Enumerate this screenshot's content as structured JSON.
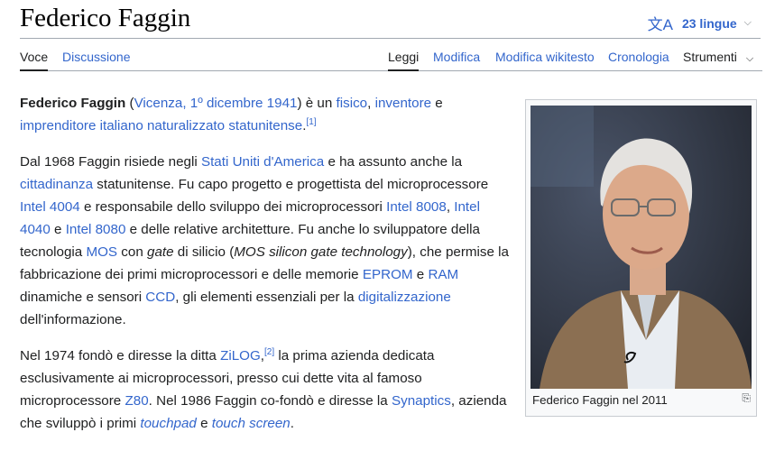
{
  "header": {
    "title": "Federico Faggin",
    "languages_label": "23 lingue"
  },
  "tabs": {
    "voce": "Voce",
    "discussione": "Discussione",
    "leggi": "Leggi",
    "modifica": "Modifica",
    "modifica_wikitesto": "Modifica wikitesto",
    "cronologia": "Cronologia",
    "strumenti": "Strumenti"
  },
  "p1": {
    "name": "Federico Faggin",
    "t1": " (",
    "l1": "Vicenza, 1º dicembre 1941",
    "t2": ") è un ",
    "l2": "fisico",
    "t3": ", ",
    "l3": "inventore",
    "t4": " e ",
    "l4": "imprenditore italiano naturalizzato statunitense",
    "t5": ".",
    "ref": "[1]"
  },
  "p2": {
    "t1": "Dal 1968 Faggin risiede negli ",
    "l1": "Stati Uniti d'America",
    "t2": " e ha assunto anche la ",
    "l2": "cittadinanza",
    "t3": " statunitense. Fu capo progetto e progettista del microprocessore ",
    "l3": "Intel 4004",
    "t4": " e responsabile dello sviluppo dei microprocessori ",
    "l4": "Intel 8008",
    "t5": ", ",
    "l5": "Intel 4040",
    "t6": " e ",
    "l6": "Intel 8080",
    "t7": " e delle relative architetture. Fu anche lo sviluppatore della tecnologia ",
    "l7": "MOS",
    "t8": " con ",
    "i1": "gate",
    "t9": " di silicio (",
    "i2": "MOS silicon gate technology",
    "t10": "), che permise la fabbricazione dei primi microprocessori e delle memorie ",
    "l8": "EPROM",
    "t11": " e ",
    "l9": "RAM",
    "t12": " dinamiche e sensori ",
    "l10": "CCD",
    "t13": ", gli elementi essenziali per la ",
    "l11": "digitalizzazione",
    "t14": " dell'informazione."
  },
  "p3": {
    "t1": "Nel 1974 fondò e diresse la ditta ",
    "l1": "ZiLOG",
    "t2": ",",
    "ref": "[2]",
    "t3": " la prima azienda dedicata esclusivamente ai microprocessori, presso cui dette vita al famoso microprocessore ",
    "l2": "Z80",
    "t4": ". Nel 1986 Faggin co-fondò e diresse la ",
    "l3": "Synaptics",
    "t5": ", azienda che sviluppò i primi ",
    "i1": "touchpad",
    "t6": " e ",
    "i2": "touch screen",
    "t7": "."
  },
  "infobox": {
    "caption": "Federico Faggin nel 2011"
  },
  "icons": {
    "translate": "translate-icon",
    "chevron": "chevron-down-icon",
    "enlarge": "enlarge-icon"
  }
}
